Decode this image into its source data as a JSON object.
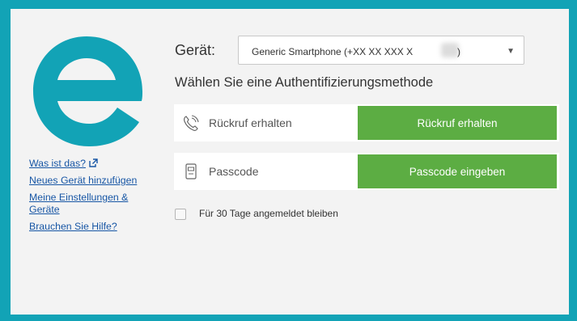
{
  "device": {
    "label": "Gerät:",
    "selected": "Generic Smartphone (+XX XX XXX X",
    "selected_suffix": ")"
  },
  "title": "Wählen Sie eine Authentifizierungsmethode",
  "methods": [
    {
      "label": "Rückruf erhalten",
      "button": "Rückruf erhalten",
      "icon": "phone-ringing-icon"
    },
    {
      "label": "Passcode",
      "button": "Passcode eingeben",
      "icon": "token-device-icon"
    }
  ],
  "remember_label": "Für 30 Tage angemeldet bleiben",
  "links": [
    {
      "text": "Was ist das?"
    },
    {
      "text": "Neues Gerät hinzufügen"
    },
    {
      "text": "Meine Einstellungen & Geräte"
    },
    {
      "text": "Brauchen Sie Hilfe?"
    }
  ],
  "colors": {
    "frame_border": "#12a3b6",
    "logo": "#12a3b6",
    "button": "#5cad43",
    "link": "#1756a5"
  }
}
